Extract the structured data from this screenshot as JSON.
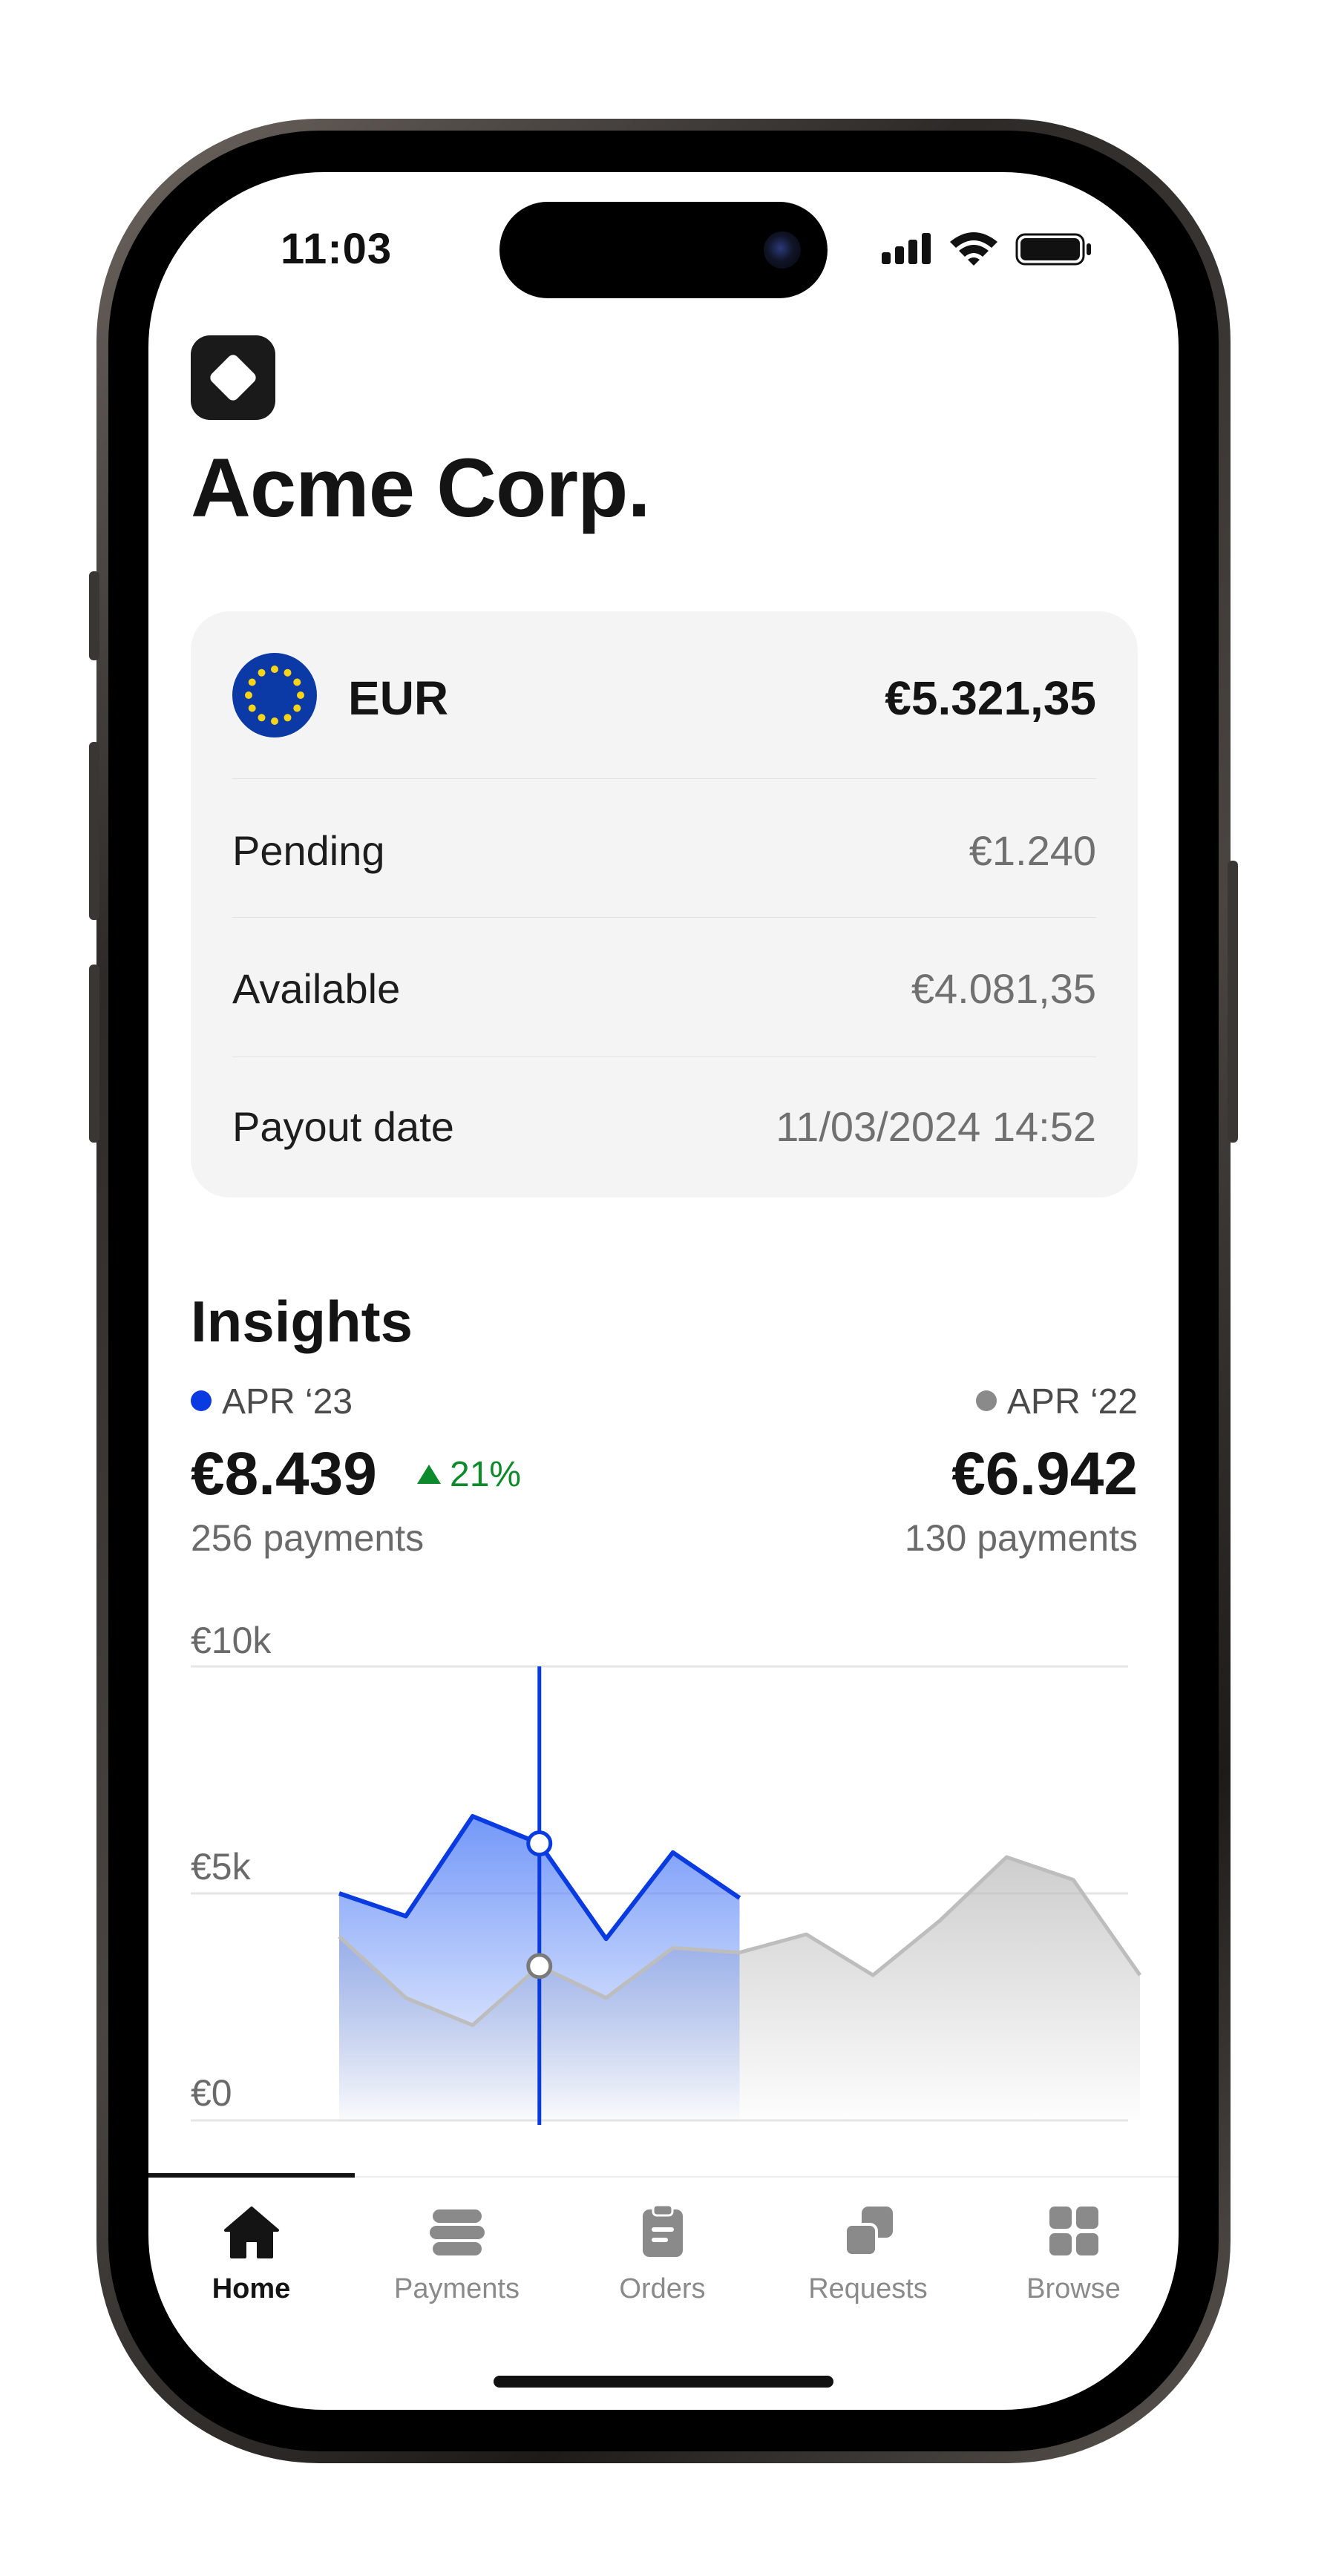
{
  "status_bar": {
    "time": "11:03"
  },
  "header": {
    "title": "Acme Corp."
  },
  "balance_card": {
    "currency": "EUR",
    "total": "€5.321,35",
    "rows": [
      {
        "label": "Pending",
        "value": "€1.240"
      },
      {
        "label": "Available",
        "value": "€4.081,35"
      },
      {
        "label": "Payout date",
        "value": "11/03/2024 14:52"
      }
    ]
  },
  "insights": {
    "title": "Insights",
    "current": {
      "period": "APR ‘23",
      "amount": "€8.439",
      "change": "21%",
      "payments": "256 payments",
      "color": "#0a3be0"
    },
    "previous": {
      "period": "APR ‘22",
      "amount": "€6.942",
      "payments": "130 payments",
      "color": "#8a8a8a"
    }
  },
  "chart_data": {
    "type": "area",
    "y_ticks": [
      "€10k",
      "€5k",
      "€0"
    ],
    "ylim": [
      0,
      10000
    ],
    "x": [
      0,
      1,
      2,
      3,
      4,
      5,
      6,
      7,
      8,
      9,
      10,
      11,
      12
    ],
    "series": [
      {
        "name": "APR ‘23",
        "color": "#0a3be0",
        "values": [
          5000,
          4500,
          6700,
          6100,
          4000,
          5900,
          4900
        ]
      },
      {
        "name": "APR ‘22",
        "color": "#bdbdbd",
        "values": [
          4050,
          2700,
          2100,
          3400,
          2700,
          3800,
          3700,
          4100,
          3200,
          4400,
          5800,
          5300,
          3200
        ]
      }
    ],
    "cursor_index": 3,
    "grid": true
  },
  "tabs": [
    {
      "label": "Home",
      "icon": "home-icon",
      "active": true
    },
    {
      "label": "Payments",
      "icon": "payments-icon",
      "active": false
    },
    {
      "label": "Orders",
      "icon": "orders-icon",
      "active": false
    },
    {
      "label": "Requests",
      "icon": "requests-icon",
      "active": false
    },
    {
      "label": "Browse",
      "icon": "browse-icon",
      "active": false
    }
  ]
}
